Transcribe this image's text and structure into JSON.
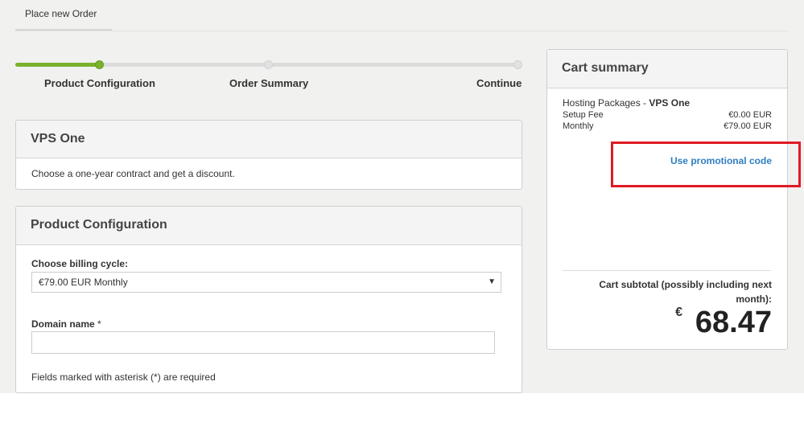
{
  "header": {
    "tab_label": "Place new Order"
  },
  "progress": {
    "completed_fraction": 0.17,
    "steps": [
      "Product Configuration",
      "Order Summary",
      "Continue"
    ]
  },
  "product_panel": {
    "title": "VPS One",
    "description": "Choose a one-year contract and get a discount."
  },
  "config_panel": {
    "title": "Product Configuration",
    "billing_label": "Choose billing cycle:",
    "billing_value": "€79.00 EUR Monthly",
    "domain_label": "Domain name",
    "domain_required_mark": "*",
    "domain_value": "",
    "required_note": "Fields marked with asterisk (*) are required"
  },
  "cart": {
    "title": "Cart summary",
    "package_prefix": "Hosting Packages - ",
    "package_name": "VPS One",
    "lines": [
      {
        "label": "Setup Fee",
        "value": "€0.00 EUR"
      },
      {
        "label": "Monthly",
        "value": "€79.00 EUR"
      }
    ],
    "promo_link": "Use promotional code",
    "subtotal_label": "Cart subtotal (possibly including next month):",
    "currency_symbol": "€",
    "total": "68.47"
  },
  "colors": {
    "accent_green": "#7ab12d",
    "link_blue": "#2f7fc1",
    "highlight_red": "#e01b24"
  }
}
